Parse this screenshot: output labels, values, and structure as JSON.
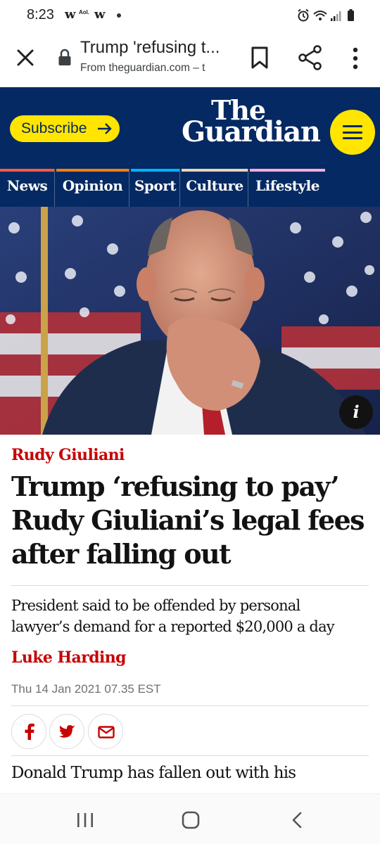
{
  "status_bar": {
    "time": "8:23",
    "notif_1": "w",
    "notif_aol": "Aol.",
    "notif_2": "w",
    "icons": [
      "alarm-icon",
      "wifi-icon",
      "signal-icon",
      "battery-icon"
    ]
  },
  "toolbar": {
    "title": "Trump 'refusing t...",
    "url": "From theguardian.com – t",
    "icons": [
      "close-icon",
      "lock-icon",
      "bookmark-icon",
      "share-icon",
      "more-vert-icon"
    ]
  },
  "header": {
    "subscribe_label": "Subscribe",
    "logo_line1": "The",
    "logo_line2": "Guardian",
    "menu_icon": "hamburger-icon",
    "brand_color": "#052962",
    "accent_color": "#ffe500"
  },
  "pillars": [
    {
      "label": "News",
      "color": "#ff5943"
    },
    {
      "label": "Opinion",
      "color": "#ff7f0f"
    },
    {
      "label": "Sport",
      "color": "#00b2ff"
    },
    {
      "label": "Culture",
      "color": "#e7d4b9"
    },
    {
      "label": "Lifestyle",
      "color": "#ffabdb"
    }
  ],
  "hero": {
    "info_label": "i"
  },
  "article": {
    "kicker": "Rudy Giuliani",
    "headline_lines": [
      "Trump ‘refusing to pay’",
      "Rudy Giuliani’s legal fees",
      "after falling out"
    ],
    "standfirst_lines": [
      "President said to be offended by personal",
      "lawyer’s demand for a reported $20,000 a day"
    ],
    "byline": "Luke Harding",
    "date": "Thu 14 Jan 2021 07.35 EST",
    "share_icons": [
      "facebook-icon",
      "twitter-icon",
      "email-icon"
    ],
    "body_first_line": "Donald Trump has fallen out with his",
    "kicker_color": "#c70000"
  },
  "nav_bar": {
    "icons": [
      "recent-apps-icon",
      "home-icon",
      "back-icon"
    ]
  }
}
